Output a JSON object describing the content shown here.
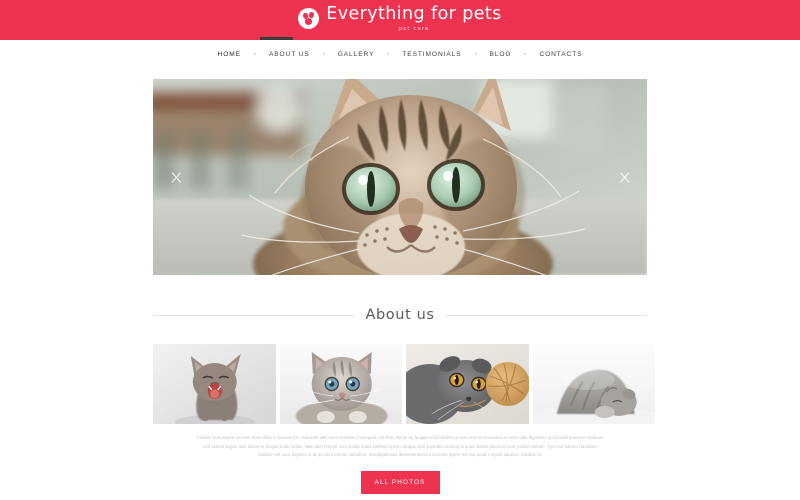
{
  "theme": {
    "brand_red": "#ee3350",
    "nav_text": "#3f3f3f",
    "body_text": "#c3c3c3",
    "heading_text": "#5a5a5a",
    "rule": "#e3e3e3",
    "active_bar": "#3d3d3d"
  },
  "header": {
    "logo_icon": "paw-circle-icon",
    "title": "Everything for pets",
    "tagline": "pet care"
  },
  "nav": {
    "items": [
      {
        "label": "HOME",
        "active": true
      },
      {
        "label": "ABOUT US",
        "active": false
      },
      {
        "label": "GALLERY",
        "active": false
      },
      {
        "label": "TESTIMONIALS",
        "active": false
      },
      {
        "label": "BLOG",
        "active": false
      },
      {
        "label": "CONTACTS",
        "active": false
      }
    ]
  },
  "hero": {
    "alt": "Close-up of a fluffy tabby cat with green eyes lying down",
    "prev_icon": "chevron-left-icon",
    "next_icon": "chevron-right-icon"
  },
  "about": {
    "title": "About us",
    "thumbnails": [
      {
        "alt": "Hairless sphynx kitten meowing on grey background"
      },
      {
        "alt": "Fluffy grey tabby kitten with blue eyes lying down"
      },
      {
        "alt": "Grey British shorthair cat playing with a ball of yarn"
      },
      {
        "alt": "Grey striped kitten sleeping on white fur blanket"
      }
    ],
    "paragraph": "Claritas Duis autem vel eum iriure dolor in hendrerit in vulputate velit esse molestie consequat, vel illum dolore eu feugiat nulla facilisis at vero eros et accumsan et iusto odio dignissim qui blandit praesent luptatum zzril delenit augue duis dolore te feugait nulla facilisi. Nam liber tempor cum soluta nobis eleifend option congue nihil imperdiet doming id quod mazim placerat facer possim assum. Typi non habent claritatem insitam; est usus legentis in iis qui facit eorum claritatem. Investigationes demonstraverunt lectores legere me lius quod ii legunt saepius. Claritas es",
    "cta_label": "ALL PHOTOS"
  }
}
